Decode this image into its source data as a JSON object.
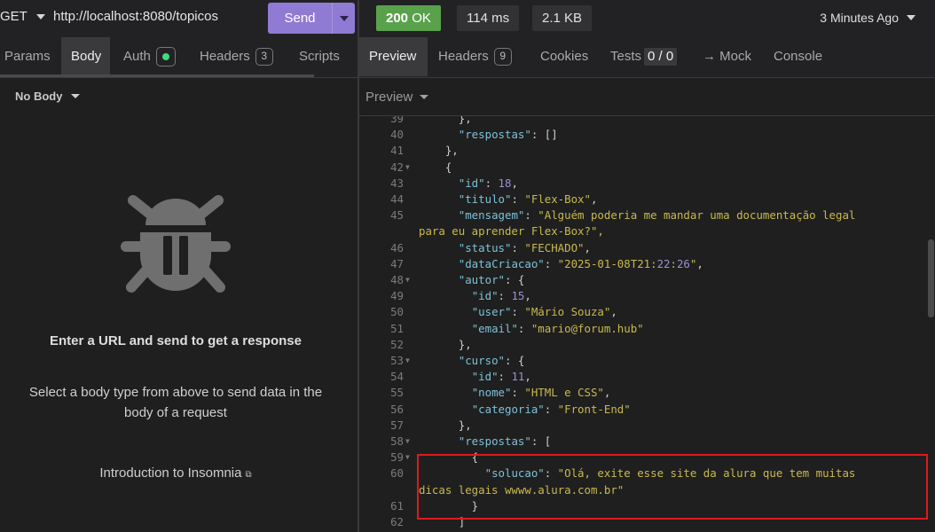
{
  "request": {
    "method": "GET",
    "url": "http://localhost:8080/topicos",
    "send_label": "Send"
  },
  "response_meta": {
    "status_code": "200",
    "status_text": "OK",
    "time": "114 ms",
    "size": "2.1 KB",
    "history": "3 Minutes Ago"
  },
  "request_tabs": [
    {
      "label": "Params"
    },
    {
      "label": "Body"
    },
    {
      "label": "Auth"
    },
    {
      "label": "Headers",
      "badge": "3"
    },
    {
      "label": "Scripts"
    }
  ],
  "response_tabs": [
    {
      "label": "Preview"
    },
    {
      "label": "Headers",
      "badge": "9"
    },
    {
      "label": "Cookies"
    },
    {
      "label": "Tests",
      "badge": "0 / 0"
    },
    {
      "label": "→ Mock"
    },
    {
      "label": "Console"
    }
  ],
  "body_type": "No Body",
  "preview_mode": "Preview",
  "empty_state": {
    "title": "Enter a URL and send to get a response",
    "description": "Select a body type from above to send data in the body of a request",
    "link": "Introduction to Insomnia"
  },
  "code_lines": [
    {
      "n": "39",
      "t": "      },"
    },
    {
      "n": "40",
      "t": "      \"respostas\": []"
    },
    {
      "n": "41",
      "t": "    },"
    },
    {
      "n": "42",
      "t": "    {",
      "fold": true
    },
    {
      "n": "43",
      "t": "      \"id\": 18,"
    },
    {
      "n": "44",
      "t": "      \"titulo\": \"Flex-Box\","
    },
    {
      "n": "45",
      "t": "      \"mensagem\": \"Alguém poderia me mandar uma documentação legal"
    },
    {
      "n": "",
      "t": "para eu aprender Flex-Box?\",",
      "wrap": true
    },
    {
      "n": "46",
      "t": "      \"status\": \"FECHADO\","
    },
    {
      "n": "47",
      "t": "      \"dataCriacao\": \"2025-01-08T21:22:26\","
    },
    {
      "n": "48",
      "t": "      \"autor\": {",
      "fold": true
    },
    {
      "n": "49",
      "t": "        \"id\": 15,"
    },
    {
      "n": "50",
      "t": "        \"user\": \"Mário Souza\","
    },
    {
      "n": "51",
      "t": "        \"email\": \"mario@forum.hub\""
    },
    {
      "n": "52",
      "t": "      },"
    },
    {
      "n": "53",
      "t": "      \"curso\": {",
      "fold": true
    },
    {
      "n": "54",
      "t": "        \"id\": 11,"
    },
    {
      "n": "55",
      "t": "        \"nome\": \"HTML e CSS\","
    },
    {
      "n": "56",
      "t": "        \"categoria\": \"Front-End\""
    },
    {
      "n": "57",
      "t": "      },"
    },
    {
      "n": "58",
      "t": "      \"respostas\": [",
      "fold": true
    },
    {
      "n": "59",
      "t": "        {",
      "fold": true
    },
    {
      "n": "60",
      "t": "          \"solucao\": \"Olá, exite esse site da alura que tem muitas"
    },
    {
      "n": "",
      "t": "dicas legais wwww.alura.com.br\"",
      "wrap": true
    },
    {
      "n": "61",
      "t": "        }"
    },
    {
      "n": "62",
      "t": "      ]"
    }
  ],
  "colors": {
    "accent": "#8f7bd3",
    "status_ok": "#5aa14c",
    "json_key": "#7ec1d8",
    "json_string": "#c9b94f",
    "json_number": "#9e8fd6",
    "highlight_border": "#e0191e"
  },
  "icons": {
    "bug": "bug-icon",
    "external_link": "external-link-icon",
    "auth_status": "auth-active-dot"
  }
}
